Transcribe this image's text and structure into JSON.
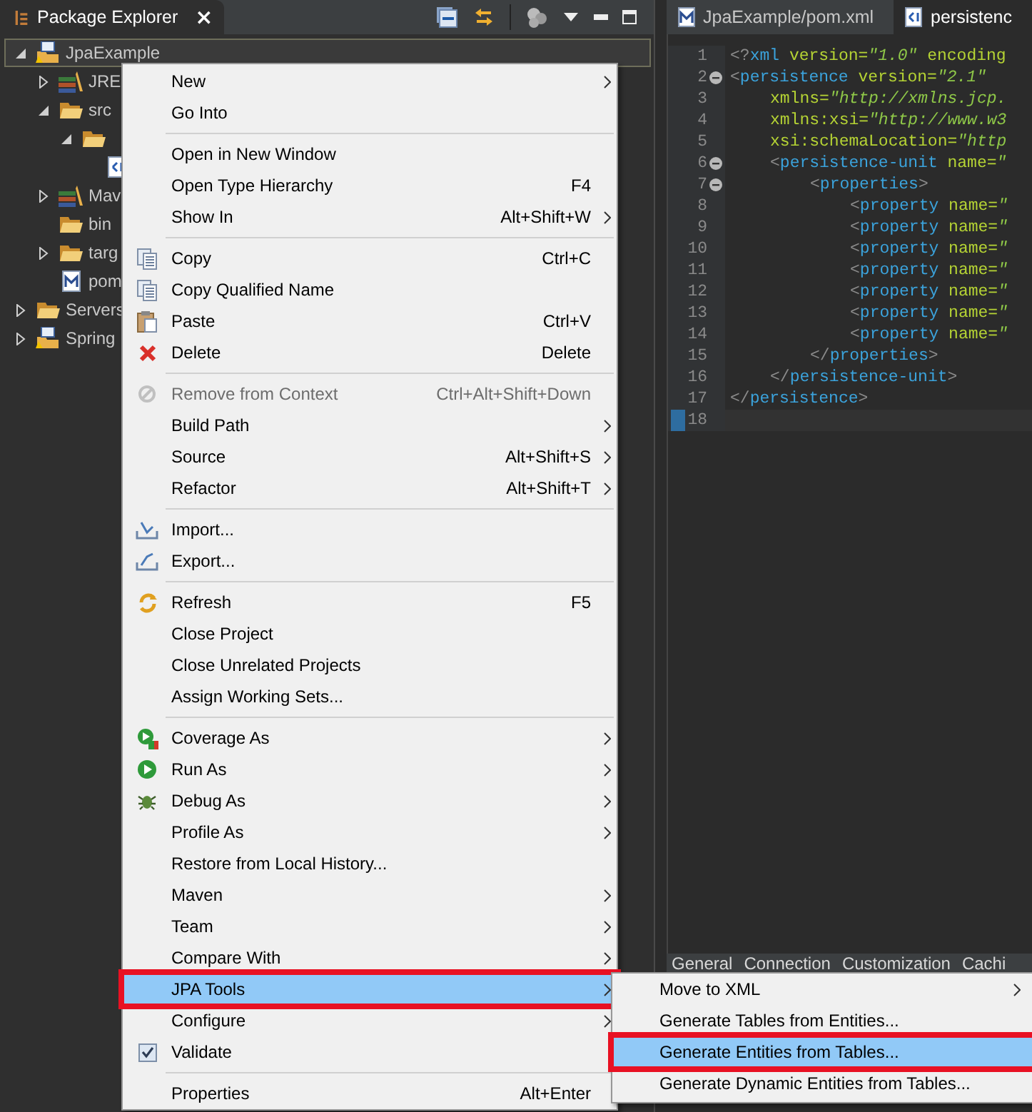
{
  "explorer": {
    "title": "Package Explorer",
    "close": "×",
    "tree": [
      {
        "label": "JpaExample",
        "kind": "project",
        "expanded": true,
        "selected": true,
        "children": [
          {
            "label": "JRE",
            "kind": "library",
            "expanded": false
          },
          {
            "label": "src",
            "kind": "folder",
            "expanded": true,
            "children": [
              {
                "kind": "folder",
                "expanded": true,
                "children": [
                  {
                    "kind": "xml-file"
                  }
                ]
              }
            ]
          },
          {
            "label": "Mav",
            "kind": "library",
            "expanded": false
          },
          {
            "label": "bin",
            "kind": "folder"
          },
          {
            "label": "targ",
            "kind": "folder",
            "expanded": false
          },
          {
            "label": "pom",
            "kind": "maven-file"
          }
        ]
      },
      {
        "label": "Servers",
        "kind": "folder",
        "expanded": false,
        "selected": false
      },
      {
        "label": "Spring",
        "kind": "project",
        "expanded": false,
        "selected": false
      }
    ]
  },
  "editor": {
    "tabs": [
      {
        "label": "JpaExample/pom.xml",
        "kind": "maven-file",
        "selected": false
      },
      {
        "label": "persistenc",
        "kind": "xml-file",
        "selected": true
      }
    ],
    "lines": [
      {
        "line_number": "1",
        "tokens": [
          {
            "kind": "punct",
            "text": "<?"
          },
          {
            "kind": "tag",
            "text": "xml"
          },
          {
            "kind": "attr",
            "text": " version="
          },
          {
            "kind": "value",
            "text": "\"1.0\""
          },
          {
            "kind": "attr",
            "text": " encoding"
          }
        ]
      },
      {
        "line_number": "2",
        "fold": true,
        "tokens": [
          {
            "kind": "punct",
            "text": "<"
          },
          {
            "kind": "tag",
            "text": "persistence"
          },
          {
            "kind": "attr",
            "text": " version="
          },
          {
            "kind": "value",
            "text": "\"2.1\""
          }
        ]
      },
      {
        "line_number": "3",
        "tokens": [
          {
            "kind": "attr",
            "text": "xmlns="
          },
          {
            "kind": "value",
            "text": "\"http://xmlns.jcp."
          }
        ]
      },
      {
        "line_number": "4",
        "tokens": [
          {
            "kind": "attr",
            "text": "xmlns:xsi="
          },
          {
            "kind": "value",
            "text": "\"http://www.w3"
          }
        ]
      },
      {
        "line_number": "5",
        "tokens": [
          {
            "kind": "attr",
            "text": "xsi:schemaLocation="
          },
          {
            "kind": "value",
            "text": "\"http"
          }
        ]
      },
      {
        "line_number": "6",
        "fold": true,
        "tokens": [
          {
            "kind": "punct",
            "text": "<"
          },
          {
            "kind": "tag",
            "text": "persistence-unit"
          },
          {
            "kind": "attr",
            "text": " name="
          },
          {
            "kind": "value",
            "text": "\""
          }
        ]
      },
      {
        "line_number": "7",
        "fold": true,
        "tokens": [
          {
            "kind": "punct",
            "text": "<"
          },
          {
            "kind": "tag",
            "text": "properties"
          },
          {
            "kind": "punct",
            "text": ">"
          }
        ]
      },
      {
        "line_number": "8",
        "tokens": [
          {
            "kind": "punct",
            "text": "<"
          },
          {
            "kind": "tag",
            "text": "property"
          },
          {
            "kind": "attr",
            "text": " name="
          },
          {
            "kind": "value",
            "text": "\""
          }
        ]
      },
      {
        "line_number": "9",
        "tokens": [
          {
            "kind": "punct",
            "text": "<"
          },
          {
            "kind": "tag",
            "text": "property"
          },
          {
            "kind": "attr",
            "text": " name="
          },
          {
            "kind": "value",
            "text": "\""
          }
        ]
      },
      {
        "line_number": "10",
        "tokens": [
          {
            "kind": "punct",
            "text": "<"
          },
          {
            "kind": "tag",
            "text": "property"
          },
          {
            "kind": "attr",
            "text": " name="
          },
          {
            "kind": "value",
            "text": "\""
          }
        ]
      },
      {
        "line_number": "11",
        "tokens": [
          {
            "kind": "punct",
            "text": "<"
          },
          {
            "kind": "tag",
            "text": "property"
          },
          {
            "kind": "attr",
            "text": " name="
          },
          {
            "kind": "value",
            "text": "\""
          }
        ]
      },
      {
        "line_number": "12",
        "tokens": [
          {
            "kind": "punct",
            "text": "<"
          },
          {
            "kind": "tag",
            "text": "property"
          },
          {
            "kind": "attr",
            "text": " name="
          },
          {
            "kind": "value",
            "text": "\""
          }
        ]
      },
      {
        "line_number": "13",
        "tokens": [
          {
            "kind": "punct",
            "text": "<"
          },
          {
            "kind": "tag",
            "text": "property"
          },
          {
            "kind": "attr",
            "text": " name="
          },
          {
            "kind": "value",
            "text": "\""
          }
        ]
      },
      {
        "line_number": "14",
        "tokens": [
          {
            "kind": "punct",
            "text": "<"
          },
          {
            "kind": "tag",
            "text": "property"
          },
          {
            "kind": "attr",
            "text": " name="
          },
          {
            "kind": "value",
            "text": "\""
          }
        ]
      },
      {
        "line_number": "15",
        "tokens": [
          {
            "kind": "punct",
            "text": "</"
          },
          {
            "kind": "tag",
            "text": "properties"
          },
          {
            "kind": "punct",
            "text": ">"
          }
        ]
      },
      {
        "line_number": "16",
        "tokens": [
          {
            "kind": "punct",
            "text": "</"
          },
          {
            "kind": "tag",
            "text": "persistence-unit"
          },
          {
            "kind": "punct",
            "text": ">"
          }
        ]
      },
      {
        "line_number": "17",
        "tokens": [
          {
            "kind": "punct",
            "text": "</"
          },
          {
            "kind": "tag",
            "text": "persistence"
          },
          {
            "kind": "punct",
            "text": ">"
          }
        ]
      },
      {
        "line_number": "18",
        "current": true
      }
    ],
    "bottom_tabs": [
      "General",
      "Connection",
      "Customization",
      "Cachi"
    ]
  },
  "context_menu": [
    {
      "kind": "item",
      "label": "New",
      "submenu": true
    },
    {
      "kind": "item",
      "label": "Go Into"
    },
    {
      "kind": "separator"
    },
    {
      "kind": "item",
      "label": "Open in New Window"
    },
    {
      "kind": "item",
      "label": "Open Type Hierarchy",
      "shortcut": "F4"
    },
    {
      "kind": "item",
      "label": "Show In",
      "shortcut": "Alt+Shift+W",
      "submenu": true
    },
    {
      "kind": "separator"
    },
    {
      "kind": "copy",
      "label": "Copy",
      "shortcut": "Ctrl+C"
    },
    {
      "kind": "copy",
      "label": "Copy Qualified Name"
    },
    {
      "kind": "paste",
      "label": "Paste",
      "shortcut": "Ctrl+V"
    },
    {
      "kind": "delete",
      "label": "Delete",
      "shortcut": "Delete"
    },
    {
      "kind": "separator"
    },
    {
      "kind": "remove",
      "label": "Remove from Context",
      "shortcut": "Ctrl+Alt+Shift+Down",
      "disabled": true
    },
    {
      "kind": "item",
      "label": "Build Path",
      "submenu": true
    },
    {
      "kind": "item",
      "label": "Source",
      "shortcut": "Alt+Shift+S",
      "submenu": true
    },
    {
      "kind": "item",
      "label": "Refactor",
      "shortcut": "Alt+Shift+T",
      "submenu": true
    },
    {
      "kind": "separator"
    },
    {
      "kind": "import",
      "label": "Import..."
    },
    {
      "kind": "export",
      "label": "Export..."
    },
    {
      "kind": "separator"
    },
    {
      "kind": "refresh",
      "label": "Refresh",
      "shortcut": "F5"
    },
    {
      "kind": "item",
      "label": "Close Project"
    },
    {
      "kind": "item",
      "label": "Close Unrelated Projects"
    },
    {
      "kind": "item",
      "label": "Assign Working Sets..."
    },
    {
      "kind": "separator"
    },
    {
      "kind": "coverage",
      "label": "Coverage As",
      "submenu": true
    },
    {
      "kind": "run",
      "label": "Run As",
      "submenu": true
    },
    {
      "kind": "debug",
      "label": "Debug As",
      "submenu": true
    },
    {
      "kind": "item",
      "label": "Profile As",
      "submenu": true
    },
    {
      "kind": "item",
      "label": "Restore from Local History..."
    },
    {
      "kind": "item",
      "label": "Maven",
      "submenu": true
    },
    {
      "kind": "item",
      "label": "Team",
      "submenu": true
    },
    {
      "kind": "item",
      "label": "Compare With",
      "submenu": true
    },
    {
      "kind": "item",
      "label": "JPA Tools",
      "submenu": true,
      "selected": true,
      "outlined": true
    },
    {
      "kind": "item",
      "label": "Configure",
      "submenu": true
    },
    {
      "kind": "checkbox",
      "label": "Validate",
      "checked": true
    },
    {
      "kind": "separator"
    },
    {
      "kind": "item",
      "label": "Properties",
      "shortcut": "Alt+Enter"
    }
  ],
  "submenu": [
    {
      "label": "Move to XML",
      "submenu": true,
      "selected": false,
      "outlined": false
    },
    {
      "label": "Generate Tables from Entities...",
      "selected": false,
      "outlined": false
    },
    {
      "label": "Generate Entities from Tables...",
      "selected": true,
      "outlined": true
    },
    {
      "label": "Generate Dynamic Entities from Tables...",
      "selected": false,
      "outlined": false
    }
  ]
}
